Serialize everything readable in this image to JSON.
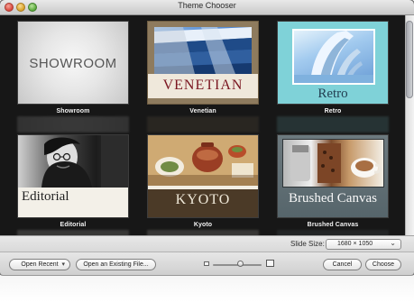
{
  "window": {
    "title": "Theme Chooser"
  },
  "themes": [
    {
      "label": "Showroom",
      "preview_text": "SHOWROOM"
    },
    {
      "label": "Venetian",
      "preview_text": "VENETIAN"
    },
    {
      "label": "Retro",
      "preview_text": "Retro"
    },
    {
      "label": "Editorial",
      "preview_text": "Editorial"
    },
    {
      "label": "Kyoto",
      "preview_text": "KYOTO"
    },
    {
      "label": "Brushed Canvas",
      "preview_text": "Brushed Canvas"
    }
  ],
  "controls": {
    "slide_size_label": "Slide Size:",
    "slide_size_value": "1680 × 1050",
    "open_recent_label": "Open Recent",
    "open_existing_label": "Open an Existing File...",
    "cancel_label": "Cancel",
    "choose_label": "Choose"
  }
}
